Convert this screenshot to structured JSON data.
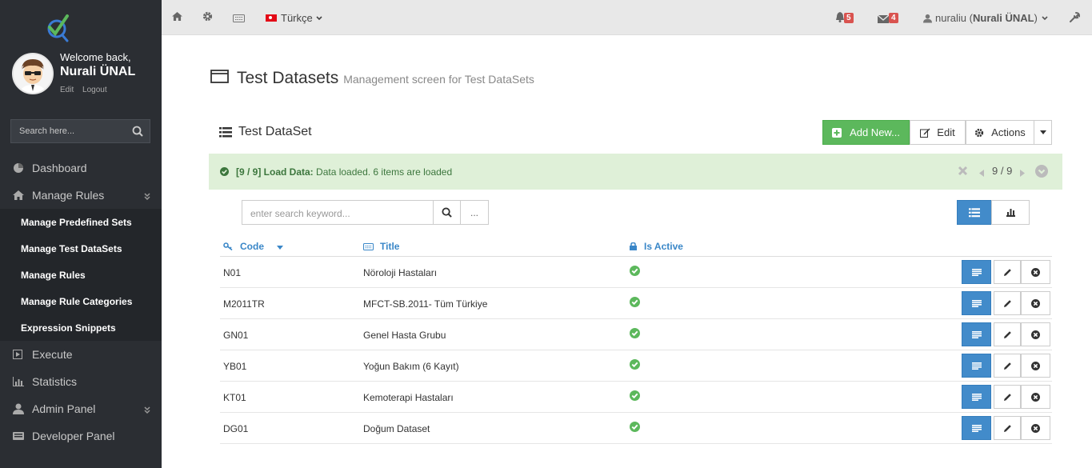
{
  "sidebar": {
    "welcome": "Welcome back,",
    "user_name": "Nurali ÜNAL",
    "edit_link": "Edit",
    "logout_link": "Logout",
    "search_placeholder": "Search here...",
    "items": {
      "dashboard": "Dashboard",
      "manage_rules": "Manage Rules",
      "execute": "Execute",
      "statistics": "Statistics",
      "admin_panel": "Admin Panel",
      "developer_panel": "Developer Panel"
    },
    "sub_items": {
      "predefined_sets": "Manage Predefined Sets",
      "test_datasets": "Manage Test DataSets",
      "rules": "Manage Rules",
      "rule_categories": "Manage Rule Categories",
      "expression_snippets": "Expression Snippets"
    }
  },
  "topbar": {
    "language": "Türkçe",
    "notifications_count": "5",
    "messages_count": "4",
    "username": "nuraliu",
    "fullname": "Nurali ÜNAL"
  },
  "page": {
    "title": "Test Datasets",
    "subtitle": "Management screen for Test DataSets"
  },
  "panel": {
    "title": "Test DataSet",
    "add_new": "Add New...",
    "edit": "Edit",
    "actions": "Actions"
  },
  "alert": {
    "prefix": "[9 / 9] Load Data:",
    "message": "Data loaded. 6 items are loaded",
    "pager": "9 / 9"
  },
  "search": {
    "placeholder": "enter search keyword...",
    "more": "..."
  },
  "table": {
    "headers": {
      "code": "Code",
      "title": "Title",
      "is_active": "Is Active"
    },
    "rows": [
      {
        "code": "N01",
        "title": "Nöroloji Hastaları",
        "active": true
      },
      {
        "code": "M2011TR",
        "title": "MFCT-SB.2011- Tüm Türkiye",
        "active": true
      },
      {
        "code": "GN01",
        "title": "Genel Hasta Grubu",
        "active": true
      },
      {
        "code": "YB01",
        "title": "Yoğun Bakım (6 Kayıt)",
        "active": true
      },
      {
        "code": "KT01",
        "title": "Kemoterapi Hastaları",
        "active": true
      },
      {
        "code": "DG01",
        "title": "Doğum Dataset",
        "active": true
      }
    ]
  },
  "colors": {
    "sidebar_bg": "#2b2e33",
    "success": "#5cb85c",
    "primary": "#428bca",
    "link": "#3a87c8",
    "alert_bg": "#dff0d8",
    "badge": "#d9534f"
  }
}
